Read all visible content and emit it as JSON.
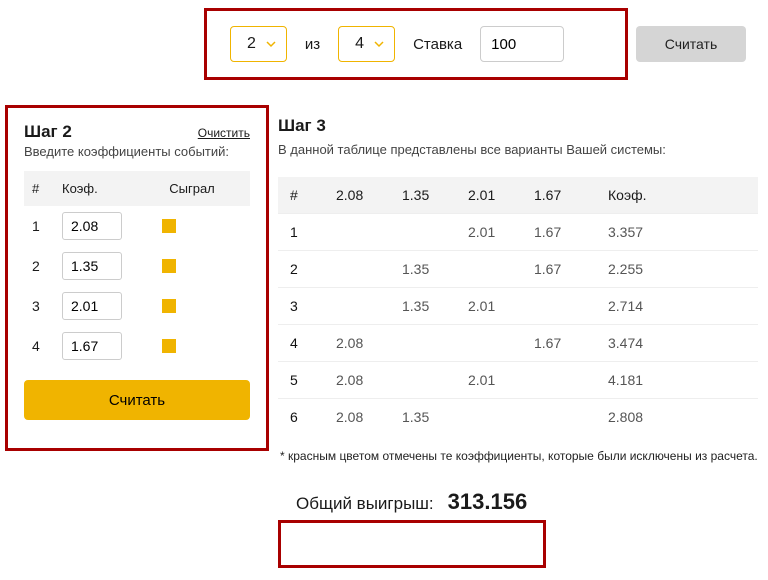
{
  "top": {
    "pick": "2",
    "of_label": "из",
    "total": "4",
    "stake_label": "Ставка",
    "stake_value": "100",
    "calc_label": "Считать"
  },
  "left": {
    "title": "Шаг 2",
    "clear": "Очистить",
    "subtitle": "Введите коэффициенты событий:",
    "head_num": "#",
    "head_coef": "Коэф.",
    "head_played": "Сыграл",
    "rows": [
      {
        "n": "1",
        "coef": "2.08"
      },
      {
        "n": "2",
        "coef": "1.35"
      },
      {
        "n": "3",
        "coef": "2.01"
      },
      {
        "n": "4",
        "coef": "1.67"
      }
    ],
    "calc_label": "Считать"
  },
  "right": {
    "title": "Шаг 3",
    "subtitle": "В данной таблице представлены все варианты Вашей системы:",
    "head": {
      "num": "#",
      "c1": "2.08",
      "c2": "1.35",
      "c3": "2.01",
      "c4": "1.67",
      "coef": "Коэф."
    },
    "rows": [
      {
        "n": "1",
        "c1": "",
        "c2": "",
        "c3": "2.01",
        "c4": "1.67",
        "coef": "3.357"
      },
      {
        "n": "2",
        "c1": "",
        "c2": "1.35",
        "c3": "",
        "c4": "1.67",
        "coef": "2.255"
      },
      {
        "n": "3",
        "c1": "",
        "c2": "1.35",
        "c3": "2.01",
        "c4": "",
        "coef": "2.714"
      },
      {
        "n": "4",
        "c1": "2.08",
        "c2": "",
        "c3": "",
        "c4": "1.67",
        "coef": "3.474"
      },
      {
        "n": "5",
        "c1": "2.08",
        "c2": "",
        "c3": "2.01",
        "c4": "",
        "coef": "4.181"
      },
      {
        "n": "6",
        "c1": "2.08",
        "c2": "1.35",
        "c3": "",
        "c4": "",
        "coef": "2.808"
      }
    ],
    "footnote": "* красным цветом отмечены те коэффициенты, которые были исключены из расчета.",
    "total_label": "Общий выигрыш:",
    "total_value": "313.156"
  }
}
